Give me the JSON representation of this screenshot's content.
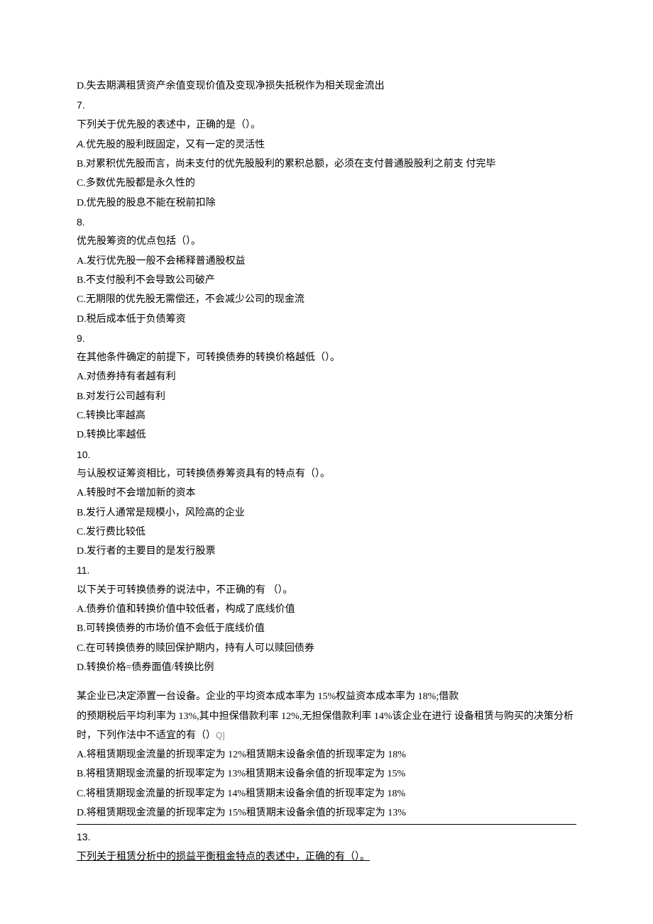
{
  "q6": {
    "optD": "D.失去期满租赁资产余值变现价值及变现净损失抵税作为相关现金流出"
  },
  "q7": {
    "num": "7.",
    "stem": "下列关于优先股的表述中，正确的是（）。",
    "optA_letter": "A.",
    "optA_text": "优先股的股利既固定，又有一定的灵活性",
    "optB": "B.对累积优先股而言，尚未支付的优先股股利的累积总额，必须在支付普通股股利之前支 付完毕",
    "optC": "C.多数优先股都是永久性的",
    "optD": "D.优先股的股息不能在税前扣除"
  },
  "q8": {
    "num": "8.",
    "stem": "优先股筹资的优点包括（）。",
    "optA": "A.发行优先股一般不会稀释普通股权益",
    "optB": "B.不支付股利不会导致公司破产",
    "optC": "C.无期限的优先股无需偿还，不会减少公司的现金流",
    "optD": "D.税后成本低于负债筹资"
  },
  "q9": {
    "num": "9.",
    "stem": "在其他条件确定的前提下，可转换债券的转换价格越低（）。",
    "optA": "A.对债券持有者越有利",
    "optB": "B.对发行公司越有利",
    "optC": "C.转换比率越高",
    "optD": "D.转换比率越低"
  },
  "q10": {
    "num": "10.",
    "stem": "与认股权证筹资相比，可转换债券筹资具有的特点有（）。",
    "optA": "A.转股时不会增加新的资本",
    "optB": "B.发行人通常是规模小，风险高的企业",
    "optC": "C.发行费比较低",
    "optD": "D.发行者的主要目的是发行股票"
  },
  "q11": {
    "num": "11.",
    "stem": "以下关于可转换债券的说法中，不正确的有 （）。",
    "optA": "A.债券价值和转换价值中较低者，构成了底线价值",
    "optB": "B.可转换债券的市场价值不会低于底线价值",
    "optC": "C.在可转换债券的赎回保护期内，持有人可以赎回债券",
    "optD": "D.转换价格=债券面值/转换比例"
  },
  "q12": {
    "stem1": "某企业已决定添置一台设备。企业的平均资本成本率为 15%权益资本成本率为 18%;借款",
    "stem2": "的预期税后平均利率为 13%,其中担保借款利率 12%,无担保借款利率 14%该企业在进行 设备租赁与购买的决策分析时，下列作法中不适宜的有（）",
    "stem2_suffix": "Q]",
    "optA": "A.将租赁期现金流量的折现率定为 12%租赁期末设备余值的折现率定为 18%",
    "optB": "B.将租赁期现金流量的折现率定为 13%租赁期末设备余值的折现率定为 15%",
    "optC": "C.将租赁期现金流量的折现率定为 14%租赁期末设备余值的折现率定为 18%",
    "optD": "D.将租赁期现金流量的折现率定为 15%租赁期末设备余值的折现率定为 13%"
  },
  "q13": {
    "num": "13.",
    "stem": "下列关于租赁分析中的损益平衡租金特点的表述中，正确的有（）。"
  }
}
